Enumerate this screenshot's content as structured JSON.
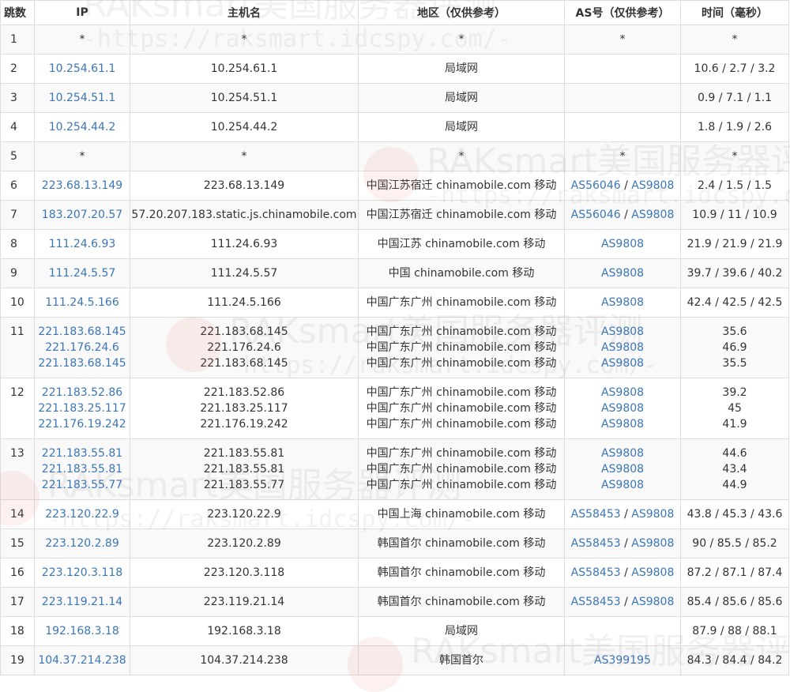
{
  "header": {
    "hop": "跳数",
    "ip": "IP",
    "host": "主机名",
    "region": "地区（仅供参考）",
    "as": "AS号（仅供参考）",
    "time": "时间（毫秒）"
  },
  "watermark": {
    "text": "RAKsmart美国服务器评测",
    "url": "-https://raksmart.idcspy.com/-"
  },
  "rows": [
    {
      "hop": "1",
      "ip": [
        "*"
      ],
      "host": [
        "*"
      ],
      "region": [
        "*"
      ],
      "as": [
        [
          "*"
        ]
      ],
      "time": [
        "*"
      ],
      "ip_link": false
    },
    {
      "hop": "2",
      "ip": [
        "10.254.61.1"
      ],
      "host": [
        "10.254.61.1"
      ],
      "region": [
        "局域网"
      ],
      "as": [
        []
      ],
      "time": [
        "10.6 / 2.7 / 3.2"
      ],
      "ip_link": true
    },
    {
      "hop": "3",
      "ip": [
        "10.254.51.1"
      ],
      "host": [
        "10.254.51.1"
      ],
      "region": [
        "局域网"
      ],
      "as": [
        []
      ],
      "time": [
        "0.9 / 7.1 / 1.1"
      ],
      "ip_link": true
    },
    {
      "hop": "4",
      "ip": [
        "10.254.44.2"
      ],
      "host": [
        "10.254.44.2"
      ],
      "region": [
        "局域网"
      ],
      "as": [
        []
      ],
      "time": [
        "1.8 / 1.9 / 2.6"
      ],
      "ip_link": true
    },
    {
      "hop": "5",
      "ip": [
        "*"
      ],
      "host": [
        "*"
      ],
      "region": [
        "*"
      ],
      "as": [
        [
          "*"
        ]
      ],
      "time": [
        "*"
      ],
      "ip_link": false
    },
    {
      "hop": "6",
      "ip": [
        "223.68.13.149"
      ],
      "host": [
        "223.68.13.149"
      ],
      "region": [
        "中国江苏宿迁 chinamobile.com 移动"
      ],
      "as": [
        [
          "AS56046",
          "AS9808"
        ]
      ],
      "time": [
        "2.4 / 1.5 / 1.5"
      ],
      "ip_link": true
    },
    {
      "hop": "7",
      "ip": [
        "183.207.20.57"
      ],
      "host": [
        "57.20.207.183.static.js.chinamobile.com"
      ],
      "region": [
        "中国江苏宿迁 chinamobile.com 移动"
      ],
      "as": [
        [
          "AS56046",
          "AS9808"
        ]
      ],
      "time": [
        "10.9 / 11 / 10.9"
      ],
      "ip_link": true
    },
    {
      "hop": "8",
      "ip": [
        "111.24.6.93"
      ],
      "host": [
        "111.24.6.93"
      ],
      "region": [
        "中国江苏 chinamobile.com 移动"
      ],
      "as": [
        [
          "AS9808"
        ]
      ],
      "time": [
        "21.9 / 21.9 / 21.9"
      ],
      "ip_link": true
    },
    {
      "hop": "9",
      "ip": [
        "111.24.5.57"
      ],
      "host": [
        "111.24.5.57"
      ],
      "region": [
        "中国 chinamobile.com 移动"
      ],
      "as": [
        [
          "AS9808"
        ]
      ],
      "time": [
        "39.7 / 39.6 / 40.2"
      ],
      "ip_link": true
    },
    {
      "hop": "10",
      "ip": [
        "111.24.5.166"
      ],
      "host": [
        "111.24.5.166"
      ],
      "region": [
        "中国广东广州 chinamobile.com 移动"
      ],
      "as": [
        [
          "AS9808"
        ]
      ],
      "time": [
        "42.4 / 42.5 / 42.5"
      ],
      "ip_link": true
    },
    {
      "hop": "11",
      "ip": [
        "221.183.68.145",
        "221.176.24.6",
        "221.183.68.145"
      ],
      "host": [
        "221.183.68.145",
        "221.176.24.6",
        "221.183.68.145"
      ],
      "region": [
        "中国广东广州 chinamobile.com 移动",
        "中国广东广州 chinamobile.com 移动",
        "中国广东广州 chinamobile.com 移动"
      ],
      "as": [
        [
          "AS9808"
        ],
        [
          "AS9808"
        ],
        [
          "AS9808"
        ]
      ],
      "time": [
        "35.6",
        "46.9",
        "35.5"
      ],
      "ip_link": true
    },
    {
      "hop": "12",
      "ip": [
        "221.183.52.86",
        "221.183.25.117",
        "221.176.19.242"
      ],
      "host": [
        "221.183.52.86",
        "221.183.25.117",
        "221.176.19.242"
      ],
      "region": [
        "中国广东广州 chinamobile.com 移动",
        "中国广东广州 chinamobile.com 移动",
        "中国广东广州 chinamobile.com 移动"
      ],
      "as": [
        [
          "AS9808"
        ],
        [
          "AS9808"
        ],
        [
          "AS9808"
        ]
      ],
      "time": [
        "39.2",
        "45",
        "41.9"
      ],
      "ip_link": true
    },
    {
      "hop": "13",
      "ip": [
        "221.183.55.81",
        "221.183.55.81",
        "221.183.55.77"
      ],
      "host": [
        "221.183.55.81",
        "221.183.55.81",
        "221.183.55.77"
      ],
      "region": [
        "中国广东广州 chinamobile.com 移动",
        "中国广东广州 chinamobile.com 移动",
        "中国广东广州 chinamobile.com 移动"
      ],
      "as": [
        [
          "AS9808"
        ],
        [
          "AS9808"
        ],
        [
          "AS9808"
        ]
      ],
      "time": [
        "44.6",
        "43.4",
        "44.9"
      ],
      "ip_link": true
    },
    {
      "hop": "14",
      "ip": [
        "223.120.22.9"
      ],
      "host": [
        "223.120.22.9"
      ],
      "region": [
        "中国上海 chinamobile.com 移动"
      ],
      "as": [
        [
          "AS58453",
          "AS9808"
        ]
      ],
      "time": [
        "43.8 / 45.3 / 43.6"
      ],
      "ip_link": true
    },
    {
      "hop": "15",
      "ip": [
        "223.120.2.89"
      ],
      "host": [
        "223.120.2.89"
      ],
      "region": [
        "韩国首尔 chinamobile.com 移动"
      ],
      "as": [
        [
          "AS58453",
          "AS9808"
        ]
      ],
      "time": [
        "90 / 85.5 / 85.2"
      ],
      "ip_link": true
    },
    {
      "hop": "16",
      "ip": [
        "223.120.3.118"
      ],
      "host": [
        "223.120.3.118"
      ],
      "region": [
        "韩国首尔 chinamobile.com 移动"
      ],
      "as": [
        [
          "AS58453",
          "AS9808"
        ]
      ],
      "time": [
        "87.2 / 87.1 / 87.4"
      ],
      "ip_link": true
    },
    {
      "hop": "17",
      "ip": [
        "223.119.21.14"
      ],
      "host": [
        "223.119.21.14"
      ],
      "region": [
        "韩国首尔 chinamobile.com 移动"
      ],
      "as": [
        [
          "AS58453",
          "AS9808"
        ]
      ],
      "time": [
        "85.4 / 85.6 / 85.6"
      ],
      "ip_link": true
    },
    {
      "hop": "18",
      "ip": [
        "192.168.3.18"
      ],
      "host": [
        "192.168.3.18"
      ],
      "region": [
        "局域网"
      ],
      "as": [
        []
      ],
      "time": [
        "87.9 / 88 / 88.1"
      ],
      "ip_link": true
    },
    {
      "hop": "19",
      "ip": [
        "104.37.214.238"
      ],
      "host": [
        "104.37.214.238"
      ],
      "region": [
        "韩国首尔"
      ],
      "as": [
        [
          "AS399195"
        ]
      ],
      "time": [
        "84.3 / 84.4 / 84.2"
      ],
      "ip_link": true
    }
  ]
}
